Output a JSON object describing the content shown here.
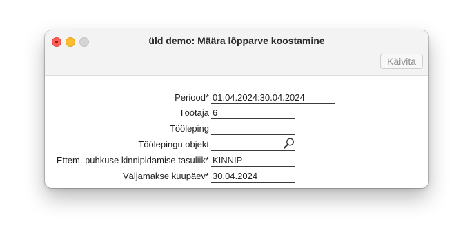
{
  "window": {
    "title": "üld demo: Määra lõpparve koostamine",
    "run_button_label": "Käivita"
  },
  "form": {
    "fields": [
      {
        "label": "Periood*",
        "value": "01.04.2024:30.04.2024"
      },
      {
        "label": "Töötaja",
        "value": "6"
      },
      {
        "label": "Tööleping",
        "value": ""
      },
      {
        "label": "Töölepingu objekt",
        "value": "",
        "icon": "magnifier-icon"
      },
      {
        "label": "Ettem. puhkuse kinnipidamise tasuliik*",
        "value": "KINNIP"
      },
      {
        "label": "Väljamakse kuupäev*",
        "value": "30.04.2024"
      }
    ]
  }
}
